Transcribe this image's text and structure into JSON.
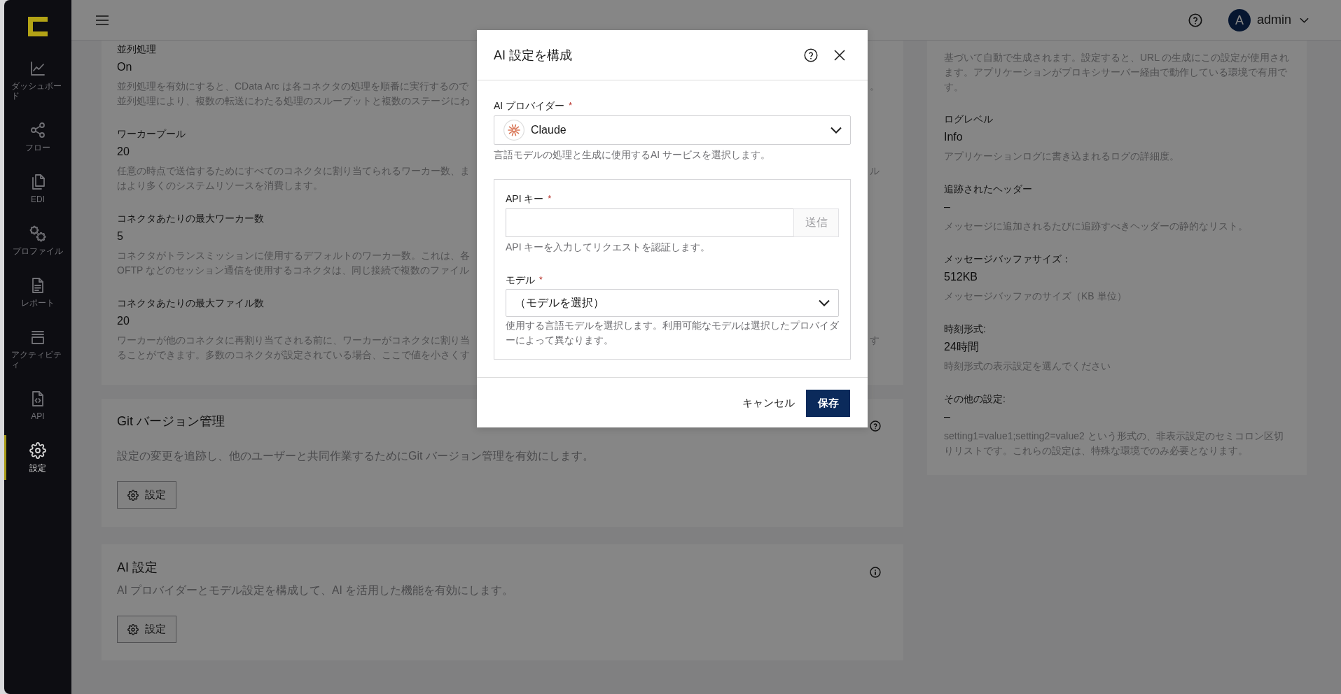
{
  "sidebar": {
    "items": [
      {
        "kind": "chart",
        "label": "ダッシュボード",
        "selected": false
      },
      {
        "kind": "share",
        "label": "フロー",
        "selected": false
      },
      {
        "kind": "files",
        "label": "EDI",
        "selected": false
      },
      {
        "kind": "gears",
        "label": "プロファイル",
        "selected": false
      },
      {
        "kind": "report",
        "label": "レポート",
        "selected": false
      },
      {
        "kind": "stack",
        "label": "アクティビティ",
        "selected": false
      },
      {
        "kind": "code",
        "label": "API",
        "selected": false
      },
      {
        "kind": "gear",
        "label": "設定",
        "selected": true
      }
    ]
  },
  "header": {
    "user": {
      "initial": "A",
      "name": "admin"
    }
  },
  "settings": {
    "items": [
      {
        "label": "並列処理",
        "value": "On",
        "description": [
          {
            "text": "並列処理を有効にすると、CData Arc は各コネクタの処理を順番に実行するので",
            "tail": "。"
          },
          {
            "text": "並列処理により、複数の転送にわたる処理のスループットと複数のステージにわ"
          }
        ]
      },
      {
        "label": "ワーカープール",
        "value": "20",
        "description": [
          {
            "text": "任意の時点で送信するためにすべてのコネクタに割り当てられるワーカー数、ま",
            "tail": "ル"
          },
          {
            "text": "はより多くのシステムリソースを消費します。"
          }
        ]
      },
      {
        "label": "コネクタあたりの最大ワーカー数",
        "value": "5",
        "description": [
          {
            "text": "コネクタがトランスミッションに使用するデフォルトのワーカー数。これは、各"
          },
          {
            "text": "OFTP などのセッション通信を使用するコネクタは、同じ接続で複数のファイル"
          }
        ]
      },
      {
        "label": "コネクタあたりの最大ファイル数",
        "value": "20",
        "description": [
          {
            "text": "ワーカーが他のコネクタに再割り当てされる前に、ワーカーがコネクタに割り当",
            "tail": "す"
          },
          {
            "text": "ることができます。多数のコネクタが設定されている場合、ここで値を小さくす"
          }
        ]
      }
    ]
  },
  "sections": [
    {
      "kind": "help",
      "title": "Git バージョン管理",
      "description": "設定の変更を追跡し、他のユーザーと共同作業するためにGit バージョン管理を有効にします。",
      "button": "設定"
    },
    {
      "kind": "info",
      "title": "AI 設定",
      "description": "AI プロバイダーとモデル設定を構成して、AI を活用した機能を有効にします。",
      "button": "設定"
    }
  ],
  "side_panel": {
    "intro": [
      "基づいて自動で生成されます。設定すると、URL の生成にこの設定が使用され",
      "ます。アプリケーションがプロキシサーバー経由で動作している環境で有用で",
      "す。"
    ],
    "items": [
      {
        "label": "ログレベル",
        "value": "Info",
        "description": [
          "アプリケーションログに書き込まれるログの詳細度。"
        ]
      },
      {
        "label": "追跡されたヘッダー",
        "value": "–",
        "description": [
          "メッセージに追加されるたびに追跡すべきヘッダーの静的なリスト。"
        ]
      },
      {
        "label": "メッセージバッファサイズ：",
        "value": "512KB",
        "description": [
          "メッセージバッファのサイズ（KB 単位）"
        ]
      },
      {
        "label": "時刻形式:",
        "value": "24時間",
        "description": [
          "時刻形式の表示設定を選んでください"
        ]
      },
      {
        "label": "その他の設定:",
        "value": "–",
        "description": [
          "setting1=value1;setting2=value2 という形式の、非表示設定のセミコロン区切",
          "りリストです。これらの設定は、特殊な環境でのみ必要となります。"
        ]
      }
    ]
  },
  "dialog": {
    "title": "AI 設定を構成",
    "provider": {
      "label": "AI プロバイダー",
      "required_mark": "*",
      "value": "Claude",
      "help": "言語モデルの処理と生成に使用するAI サービスを選択します。"
    },
    "api_key": {
      "label": "API キー",
      "required_mark": "*",
      "send_button": {
        "label": "送信",
        "disabled": true
      },
      "help": "API キーを入力してリクエストを認証します。"
    },
    "model": {
      "label": "モデル",
      "required_mark": "*",
      "value": "（モデルを選択）",
      "help": [
        "使用する言語モデルを選択します。利用可能なモデルは選択したプロバイダ",
        "ーによって異なります。"
      ]
    },
    "cancel": "キャンセル",
    "save": "保存"
  }
}
